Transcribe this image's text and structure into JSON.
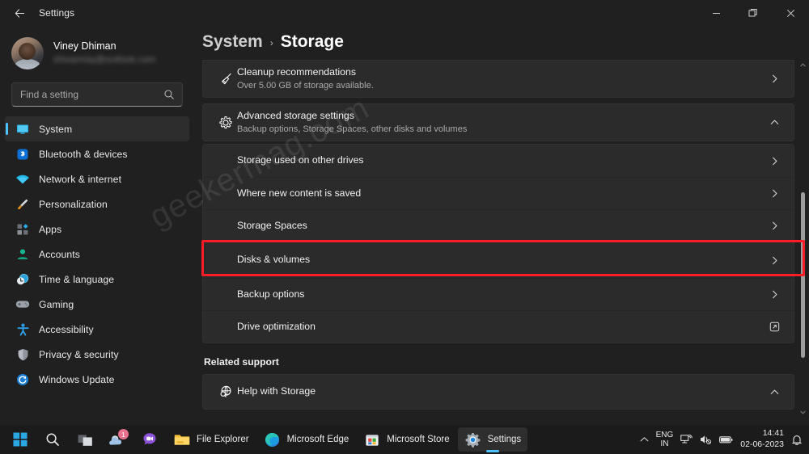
{
  "window": {
    "title": "Settings",
    "back_label": "Back",
    "minimize_label": "Minimize",
    "restore_label": "Restore",
    "close_label": "Close"
  },
  "account": {
    "name": "Viney Dhiman",
    "email": "shivaniray@outlook.com"
  },
  "search": {
    "placeholder": "Find a setting",
    "value": ""
  },
  "sidebar": {
    "items": [
      {
        "label": "System",
        "icon": "monitor-icon",
        "active": true
      },
      {
        "label": "Bluetooth & devices",
        "icon": "bluetooth-icon",
        "active": false
      },
      {
        "label": "Network & internet",
        "icon": "wifi-icon",
        "active": false
      },
      {
        "label": "Personalization",
        "icon": "brush-icon",
        "active": false
      },
      {
        "label": "Apps",
        "icon": "apps-icon",
        "active": false
      },
      {
        "label": "Accounts",
        "icon": "person-icon",
        "active": false
      },
      {
        "label": "Time & language",
        "icon": "clock-globe-icon",
        "active": false
      },
      {
        "label": "Gaming",
        "icon": "gamepad-icon",
        "active": false
      },
      {
        "label": "Accessibility",
        "icon": "accessibility-icon",
        "active": false
      },
      {
        "label": "Privacy & security",
        "icon": "shield-icon",
        "active": false
      },
      {
        "label": "Windows Update",
        "icon": "update-icon",
        "active": false
      }
    ]
  },
  "breadcrumb": {
    "parent": "System",
    "separator": "›",
    "current": "Storage"
  },
  "main": {
    "cleanup": {
      "title": "Cleanup recommendations",
      "subtitle": "Over 5.00 GB of storage available.",
      "icon": "broom-icon",
      "chevron": "chevron-right"
    },
    "advanced": {
      "title": "Advanced storage settings",
      "subtitle": "Backup options, Storage Spaces, other disks and volumes",
      "icon": "gear-icon",
      "chevron": "chevron-up"
    },
    "sub_items": [
      {
        "label": "Storage used on other drives",
        "chevron": "chevron-right",
        "highlighted": false
      },
      {
        "label": "Where new content is saved",
        "chevron": "chevron-right",
        "highlighted": false
      },
      {
        "label": "Storage Spaces",
        "chevron": "chevron-right",
        "highlighted": false
      },
      {
        "label": "Disks & volumes",
        "chevron": "chevron-right",
        "highlighted": true
      },
      {
        "label": "Backup options",
        "chevron": "chevron-right",
        "highlighted": false
      },
      {
        "label": "Drive optimization",
        "chevron": "external-link",
        "highlighted": false
      }
    ],
    "related_support_title": "Related support",
    "help": {
      "title": "Help with Storage",
      "icon": "globe-search-icon",
      "chevron": "chevron-up"
    }
  },
  "watermark": {
    "text": "geekermag.com"
  },
  "highlight": {
    "color": "#fb1c25",
    "target": "Disks & volumes"
  },
  "accent": {
    "color": "#4cc2ff"
  },
  "taskbar": {
    "items": [
      {
        "label": "",
        "icon": "start-icon",
        "active": false,
        "badge": ""
      },
      {
        "label": "",
        "icon": "search-icon",
        "active": false,
        "badge": ""
      },
      {
        "label": "",
        "icon": "task-view-icon",
        "active": false,
        "badge": ""
      },
      {
        "label": "",
        "icon": "widgets-icon",
        "active": false,
        "badge": "1"
      },
      {
        "label": "",
        "icon": "chat-icon",
        "active": false,
        "badge": ""
      },
      {
        "label": "File Explorer",
        "icon": "file-explorer-icon",
        "active": false,
        "badge": ""
      },
      {
        "label": "Microsoft Edge",
        "icon": "edge-icon",
        "active": false,
        "badge": ""
      },
      {
        "label": "Microsoft Store",
        "icon": "store-icon",
        "active": false,
        "badge": ""
      },
      {
        "label": "Settings",
        "icon": "settings-gear-icon",
        "active": true,
        "badge": ""
      }
    ],
    "tray": {
      "overflow": "chevron-up-icon",
      "language_line1": "ENG",
      "language_line2": "IN",
      "network": "network-icon",
      "volume": "speaker-muted-icon",
      "battery": "battery-icon",
      "time": "14:41",
      "date": "02-06-2023",
      "notifications": "notification-bell-icon"
    }
  }
}
